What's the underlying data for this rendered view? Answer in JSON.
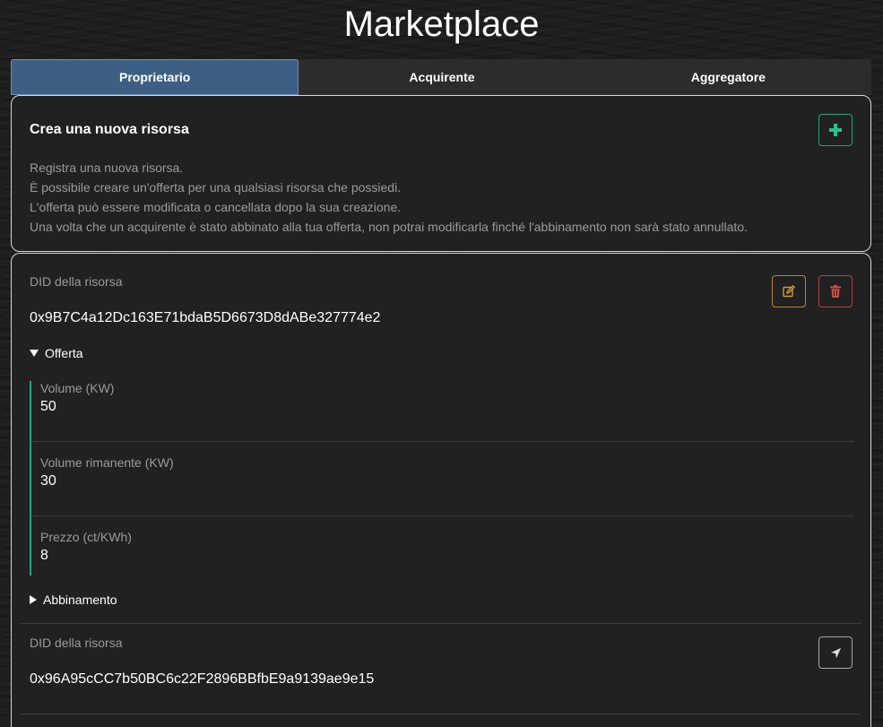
{
  "page": {
    "title": "Marketplace"
  },
  "tabs": [
    {
      "label": "Proprietario",
      "active": true
    },
    {
      "label": "Acquirente",
      "active": false
    },
    {
      "label": "Aggregatore",
      "active": false
    }
  ],
  "create": {
    "title": "Crea una nuova risorsa",
    "lines": [
      "Registra una nuova risorsa.",
      "È possibile creare un'offerta per una qualsiasi risorsa che possiedi.",
      "L'offerta può essere modificata o cancellata dopo la sua creazione.",
      "Una volta che un acquirente è stato abbinato alla tua offerta, non potrai modificarla finché l'abbinamento non sarà stato annullato."
    ],
    "add_icon": "plus-icon"
  },
  "resources": [
    {
      "did_label": "DID della risorsa",
      "did_value": "0x9B7C4a12Dc163E71bdaB5D6673D8dABe327774e2",
      "offer_label": "Offerta",
      "offer": [
        {
          "label": "Volume (KW)",
          "value": "50"
        },
        {
          "label": "Volume rimanente (KW)",
          "value": "30"
        },
        {
          "label": "Prezzo (ct/KWh)",
          "value": "8"
        }
      ],
      "match_label": "Abbinamento",
      "edit_icon": "edit-icon",
      "delete_icon": "trash-icon"
    },
    {
      "did_label": "DID della risorsa",
      "did_value": "0x96A95cCC7b50BC6c22F2896BBfbE9a9139ae9e15",
      "send_icon": "send-icon"
    }
  ],
  "colors": {
    "active_tab": "#3d5f83",
    "add": "#26c08f",
    "edit": "#d29a3a",
    "delete": "#d34a45",
    "offer_accent": "#1fa57f"
  }
}
